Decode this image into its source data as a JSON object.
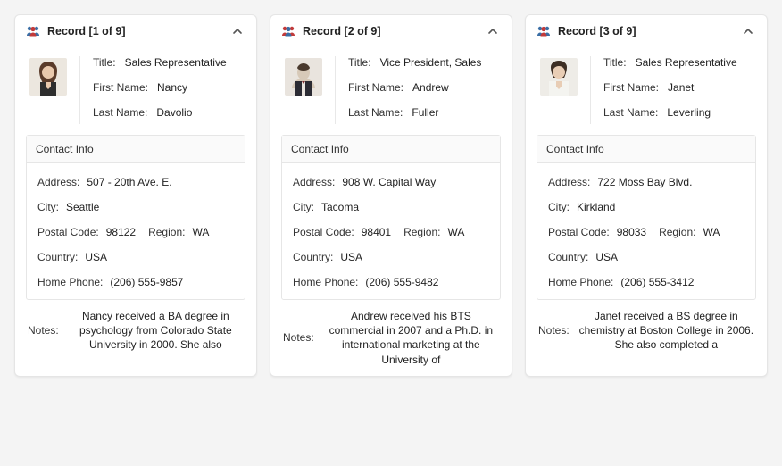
{
  "labels": {
    "title": "Title:",
    "firstName": "First Name:",
    "lastName": "Last Name:",
    "contactInfo": "Contact Info",
    "address": "Address:",
    "city": "City:",
    "postalCode": "Postal Code:",
    "region": "Region:",
    "country": "Country:",
    "homePhone": "Home Phone:",
    "notes": "Notes:"
  },
  "records": [
    {
      "header": "Record [1 of 9]",
      "iconColors": [
        "#3a6ea5",
        "#c23a3a",
        "#3a6ea5"
      ],
      "avatarKey": "female1",
      "title": "Sales Representative",
      "firstName": "Nancy",
      "lastName": "Davolio",
      "address": "507 - 20th Ave. E.",
      "city": "Seattle",
      "postalCode": "98122",
      "region": "WA",
      "country": "USA",
      "homePhone": "(206) 555-9857",
      "notes": "Nancy received a BA degree in psychology from Colorado State University in 2000. She also"
    },
    {
      "header": "Record [2 of 9]",
      "iconColors": [
        "#c23a3a",
        "#3a6ea5",
        "#c23a3a"
      ],
      "avatarKey": "male1",
      "title": "Vice President, Sales",
      "firstName": "Andrew",
      "lastName": "Fuller",
      "address": "908 W. Capital Way",
      "city": "Tacoma",
      "postalCode": "98401",
      "region": "WA",
      "country": "USA",
      "homePhone": "(206) 555-9482",
      "notes": "Andrew received his BTS commercial in 2007 and a Ph.D. in international marketing at the University of"
    },
    {
      "header": "Record [3 of 9]",
      "iconColors": [
        "#3a6ea5",
        "#c23a3a",
        "#3a6ea5"
      ],
      "avatarKey": "female2",
      "title": "Sales Representative",
      "firstName": "Janet",
      "lastName": "Leverling",
      "address": "722 Moss Bay Blvd.",
      "city": "Kirkland",
      "postalCode": "98033",
      "region": "WA",
      "country": "USA",
      "homePhone": "(206) 555-3412",
      "notes": "Janet received a BS degree in chemistry at Boston College in 2006. She also completed a"
    }
  ]
}
